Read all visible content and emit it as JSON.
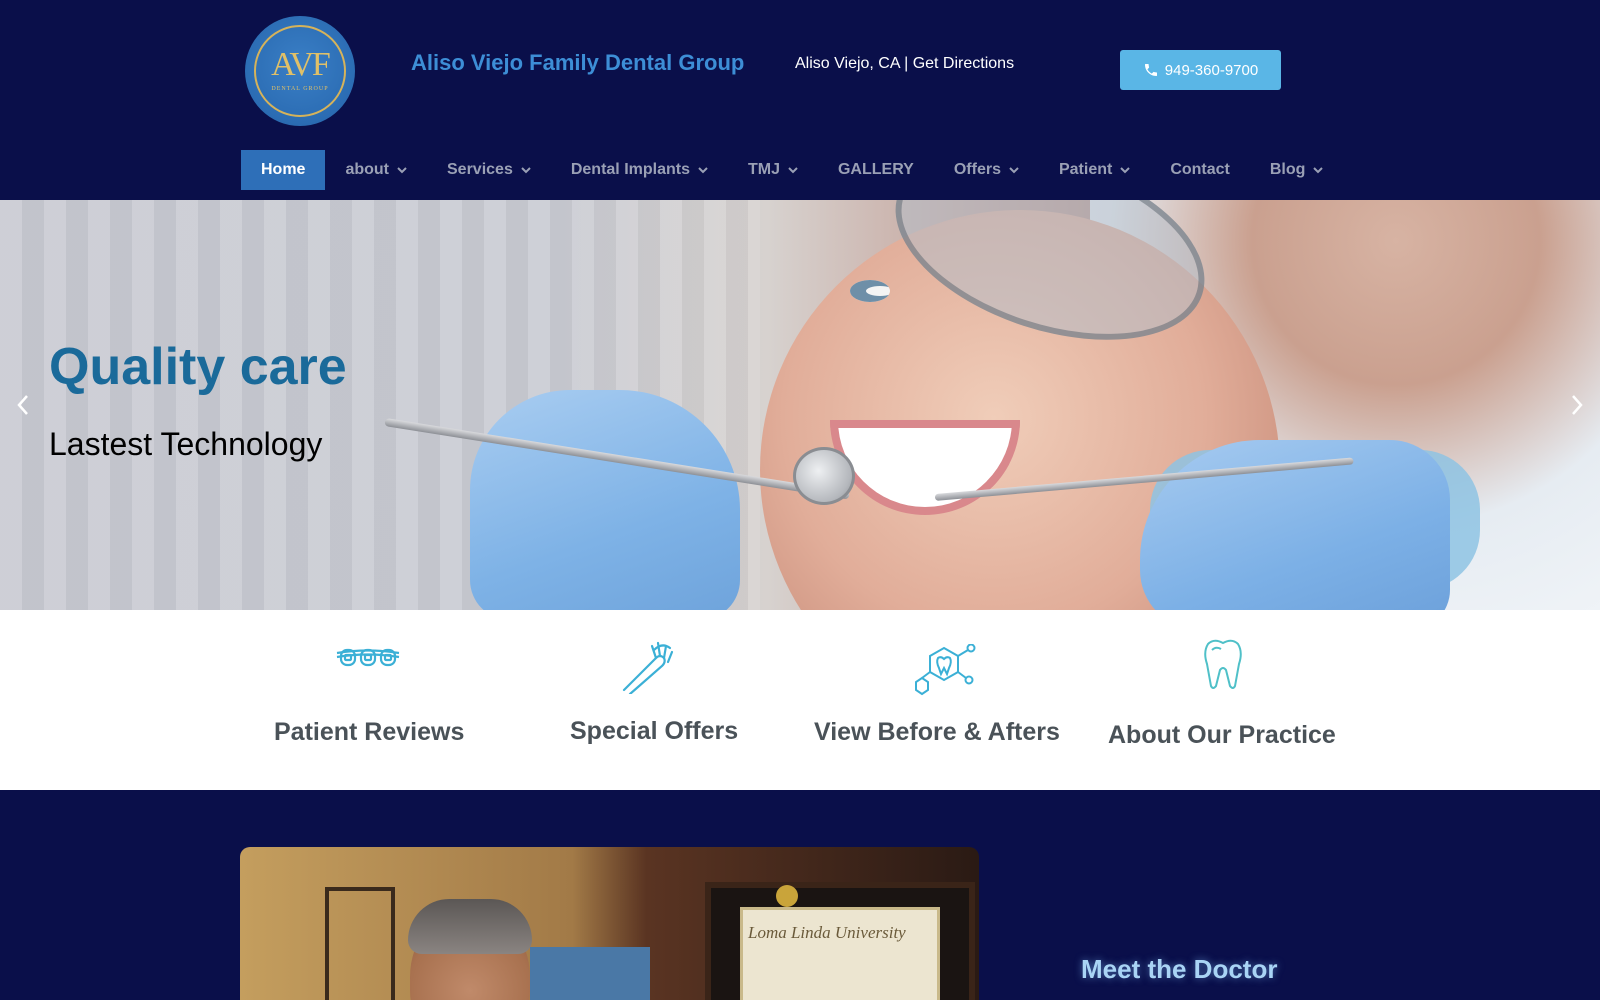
{
  "header": {
    "logo_mark": "AVF",
    "logo_sub": "DENTAL GROUP",
    "brand": "Aliso Viejo Family Dental Group",
    "location": "Aliso Viejo, CA | Get Directions",
    "phone": "949-360-9700"
  },
  "nav": {
    "items": [
      {
        "label": "Home",
        "dropdown": false,
        "active": true
      },
      {
        "label": "about",
        "dropdown": true
      },
      {
        "label": "Services",
        "dropdown": true
      },
      {
        "label": "Dental Implants",
        "dropdown": true
      },
      {
        "label": "TMJ",
        "dropdown": true
      },
      {
        "label": "GALLERY",
        "dropdown": false
      },
      {
        "label": "Offers",
        "dropdown": true
      },
      {
        "label": "Patient",
        "dropdown": true
      },
      {
        "label": "Contact",
        "dropdown": false
      },
      {
        "label": "Blog",
        "dropdown": true
      }
    ]
  },
  "hero": {
    "title": "Quality care",
    "subtitle": "Lastest Technology"
  },
  "features": [
    {
      "label": "Patient Reviews",
      "icon": "braces-icon"
    },
    {
      "label": "Special Offers",
      "icon": "toothbrush-icon"
    },
    {
      "label": "View Before & Afters",
      "icon": "tooth-molecule-icon"
    },
    {
      "label": "About Our Practice",
      "icon": "tooth-icon"
    }
  ],
  "doctor": {
    "diploma_title": "Loma Linda University",
    "heading": "Meet the Doctor"
  },
  "colors": {
    "navy": "#0a0f4a",
    "brand_blue": "#3d8ed6",
    "phone_button": "#5ab6e6",
    "active_nav": "#2e6fb8",
    "hero_title": "#1a6a9a",
    "icon_teal": "#3bb0d6"
  }
}
